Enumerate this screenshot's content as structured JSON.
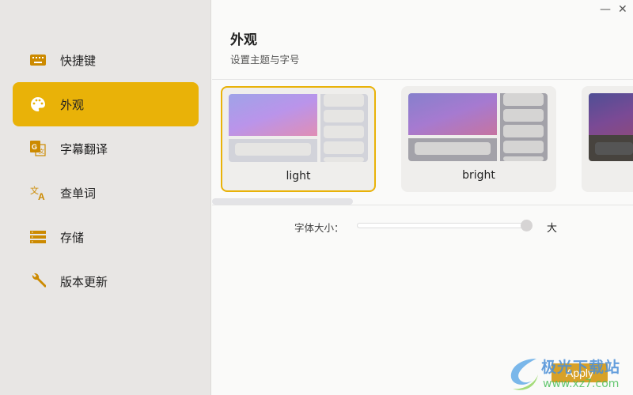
{
  "sidebar": {
    "items": [
      {
        "label": "快捷键",
        "icon": "keyboard-icon"
      },
      {
        "label": "外观",
        "icon": "palette-icon",
        "active": true
      },
      {
        "label": "字幕翻译",
        "icon": "google-translate-icon"
      },
      {
        "label": "查单词",
        "icon": "translate-icon"
      },
      {
        "label": "存储",
        "icon": "storage-icon"
      },
      {
        "label": "版本更新",
        "icon": "wrench-icon"
      }
    ]
  },
  "window": {
    "minimize": "—",
    "close": "✕"
  },
  "header": {
    "title": "外观",
    "subtitle": "设置主题与字号"
  },
  "themes": [
    {
      "label": "light",
      "selected": true
    },
    {
      "label": "bright"
    },
    {
      "label": ""
    }
  ],
  "font_size": {
    "label": "字体大小：",
    "max_label": "大",
    "value_fraction": 1.0
  },
  "apply_label": "Apply",
  "watermark": {
    "text": "极光下载站",
    "url_text": "www.xz7.com"
  },
  "colors": {
    "accent": "#e9b208",
    "icon": "#cc8a00",
    "apply": "#d7a128"
  }
}
